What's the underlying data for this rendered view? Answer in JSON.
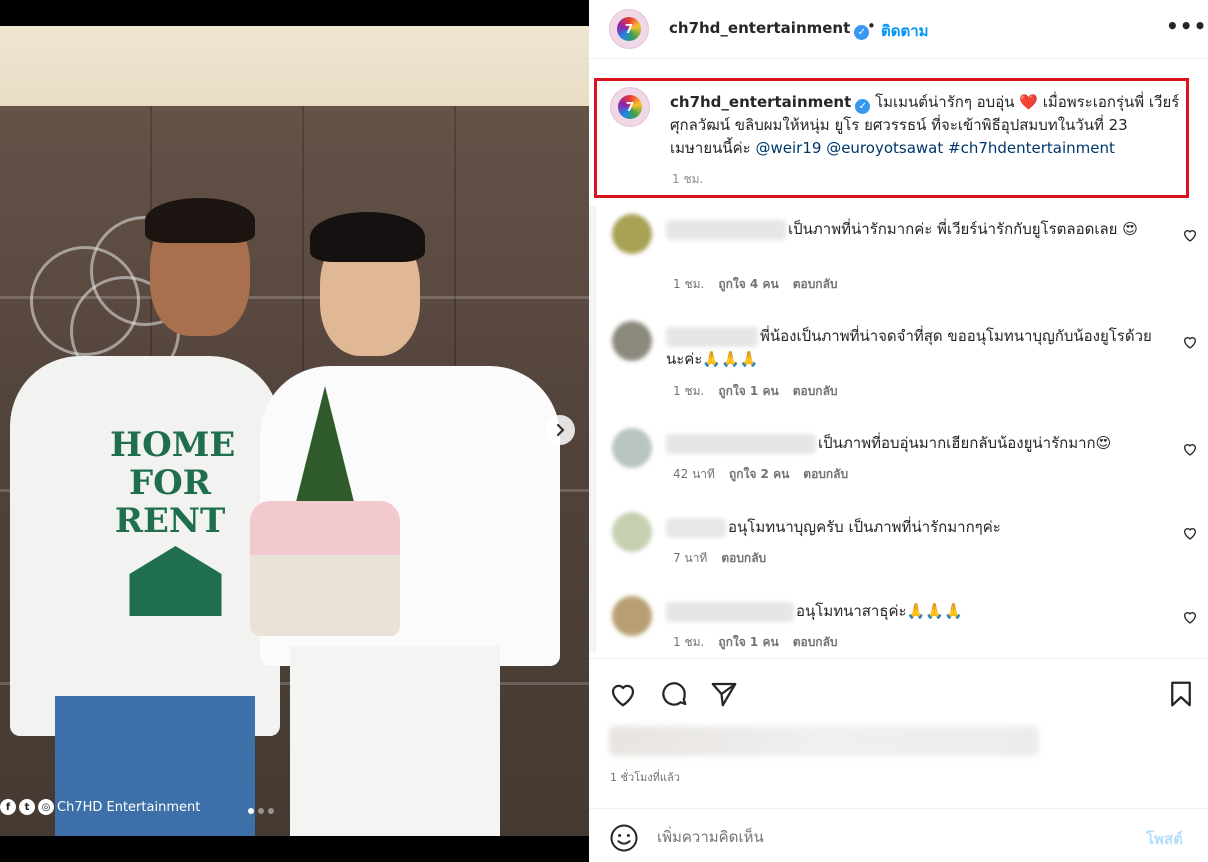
{
  "photo": {
    "shirt_print": [
      "HOME",
      "FOR",
      "RENT"
    ],
    "watermark": "Ch7HD Entertainment",
    "slide_count": 3,
    "active_slide": 0
  },
  "header": {
    "username": "ch7hd_entertainment",
    "verified": true,
    "separator": "•",
    "follow_label": "ติดตาม",
    "more_label": "•••"
  },
  "caption": {
    "username": "ch7hd_entertainment",
    "text_part1": "โมเมนต์น่ารักๆ อบอุ่น ",
    "emoji": "❤️",
    "text_part2": " เมื่อพระเอกรุ่นพี่ เวียร์ ศุกลวัฒน์ ขลิบผมให้หนุ่ม ยูโร ยศวรรธน์ ที่จะเข้าพิธีอุปสมบทในวันที่ 23 เมษายนนี้ค่ะ ",
    "tags": [
      "@weir19",
      "@euroyotsawat",
      "#ch7hdentertainment"
    ],
    "time": "1 ชม."
  },
  "comments": [
    {
      "text": "เป็นภาพที่น่ารักมากค่ะ พี่เวียร์น่ารักกับยูโรตลอดเลย 😍",
      "time": "1 ชม.",
      "likes": "ถูกใจ 4 คน",
      "reply": "ตอบกลับ",
      "avatar_color": "#a8a254"
    },
    {
      "text": "พี่น้องเป็นภาพที่น่าจดจำที่สุด ขออนุโมทนาบุญกับน้องยูโรด้วยนะค่ะ🙏🙏🙏",
      "time": "1 ชม.",
      "likes": "ถูกใจ 1 คน",
      "reply": "ตอบกลับ",
      "avatar_color": "#8c8a7e"
    },
    {
      "text": "เป็นภาพที่อบอุ่นมากเฮียกลับน้องยูน่ารักมาก😍",
      "time": "42 นาที",
      "likes": "ถูกใจ 2 คน",
      "reply": "ตอบกลับ",
      "avatar_color": "#b9c4c0"
    },
    {
      "text": "อนุโมทนาบุญครับ เป็นภาพที่น่ารักมากๆค่ะ",
      "time": "7 นาที",
      "likes": "",
      "reply": "ตอบกลับ",
      "avatar_color": "#c6d0b0"
    },
    {
      "text": "อนุโมทนาสาธุค่ะ🙏🙏🙏",
      "time": "1 ชม.",
      "likes": "ถูกใจ 1 คน",
      "reply": "ตอบกลับ",
      "avatar_color": "#b8a074"
    }
  ],
  "actions": {
    "like": "heart-icon",
    "comment": "comment-icon",
    "share": "send-icon",
    "save": "bookmark-icon"
  },
  "posted_ago": "1 ชั่วโมงที่แล้ว",
  "add_comment": {
    "placeholder": "เพิ่มความคิดเห็น",
    "post_label": "โพสต์"
  },
  "colors": {
    "accent": "#0095f6",
    "highlight_border": "#d9141c",
    "verified": "#3897f0",
    "post_disabled": "#b2dffc"
  }
}
